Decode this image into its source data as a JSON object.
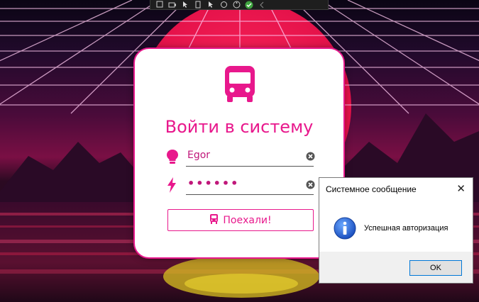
{
  "login": {
    "title": "Войти в систему",
    "username_value": "Egor",
    "password_value": "••••••",
    "submit_label": "Поехали!"
  },
  "dialog": {
    "title": "Системное сообщение",
    "message": "Успешная авторизация",
    "ok_label": "OK"
  },
  "colors": {
    "accent": "#e8188c",
    "dialog_info_blue": "#1b5fd6"
  },
  "icons": {
    "logo": "bus-icon",
    "username": "lightbulb-icon",
    "password": "lightning-icon",
    "clear": "clear-circle-icon",
    "submit": "bus-small-icon",
    "dialog": "info-icon"
  }
}
